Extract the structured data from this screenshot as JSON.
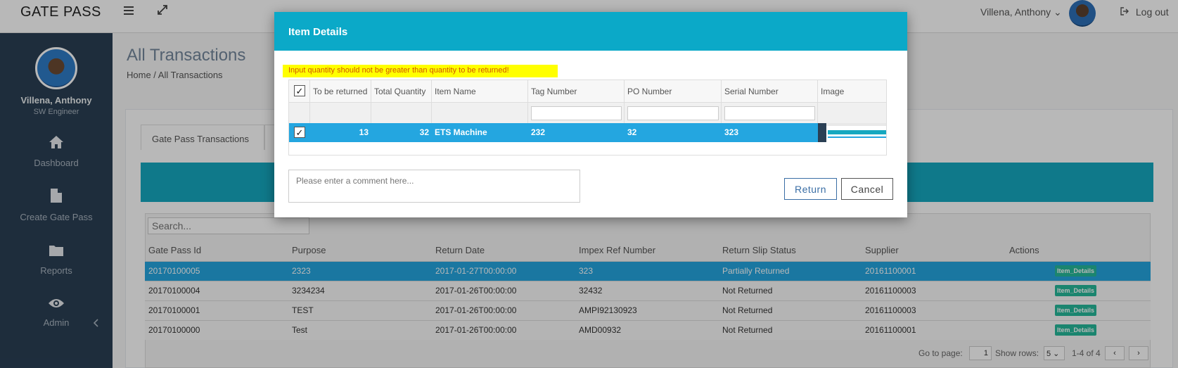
{
  "header": {
    "brand": "GATE PASS",
    "user_name": "Villena, Anthony",
    "user_caret": "⌄",
    "logout_label": "Log out"
  },
  "sidebar": {
    "name": "Villena, Anthony",
    "role": "SW Engineer",
    "items": [
      {
        "label": "Dashboard",
        "icon": "home-icon"
      },
      {
        "label": "Create Gate Pass",
        "icon": "file-icon"
      },
      {
        "label": "Reports",
        "icon": "folder-icon"
      },
      {
        "label": "Admin",
        "icon": "eye-icon"
      }
    ]
  },
  "page": {
    "title": "All Transactions",
    "breadcrumb": "Home / All Transactions",
    "tab_label": "Gate Pass Transactions"
  },
  "grid": {
    "search_placeholder": "Search...",
    "columns": [
      "Gate Pass Id",
      "Purpose",
      "Return Date",
      "Impex Ref Number",
      "Return Slip Status",
      "Supplier",
      "Actions"
    ],
    "rows": [
      {
        "id": "20170100005",
        "purpose": "2323",
        "date": "2017-01-27T00:00:00",
        "impex": "323",
        "status": "Partially Returned",
        "supplier": "20161100001",
        "action": "Item_Details"
      },
      {
        "id": "20170100004",
        "purpose": "3234234",
        "date": "2017-01-26T00:00:00",
        "impex": "32432",
        "status": "Not Returned",
        "supplier": "20161100003",
        "action": "Item_Details"
      },
      {
        "id": "20170100001",
        "purpose": "TEST",
        "date": "2017-01-26T00:00:00",
        "impex": "AMPI92130923",
        "status": "Not Returned",
        "supplier": "20161100003",
        "action": "Item_Details"
      },
      {
        "id": "20170100000",
        "purpose": "Test",
        "date": "2017-01-26T00:00:00",
        "impex": "AMD00932",
        "status": "Not Returned",
        "supplier": "20161100001",
        "action": "Item_Details"
      }
    ],
    "pager": {
      "go_to_label": "Go to page:",
      "page_value": "1",
      "show_rows_label": "Show rows:",
      "rows_value": "5",
      "range": "1-4 of 4",
      "prev": "‹",
      "next": "›"
    }
  },
  "modal": {
    "title": "Item Details",
    "warning": "Input quantity should not be greater than quantity to be returned!",
    "columns": [
      "✓",
      "To be returned",
      "Total Quantity",
      "Item Name",
      "Tag Number",
      "PO Number",
      "Serial Number",
      "Image"
    ],
    "row": {
      "checked": "✓",
      "to_be_returned": "13",
      "total_quantity": "32",
      "item_name": "ETS Machine",
      "tag_number": "232",
      "po_number": "32",
      "serial_number": "323"
    },
    "comment_placeholder": "Please enter a comment here...",
    "return_label": "Return",
    "cancel_label": "Cancel"
  },
  "colors": {
    "header_teal": "#0ba9c8",
    "row_selected": "#24a6e0",
    "sidebar": "#2a3f54",
    "warning_bg": "#ffff00",
    "button_green": "#26b99a"
  }
}
